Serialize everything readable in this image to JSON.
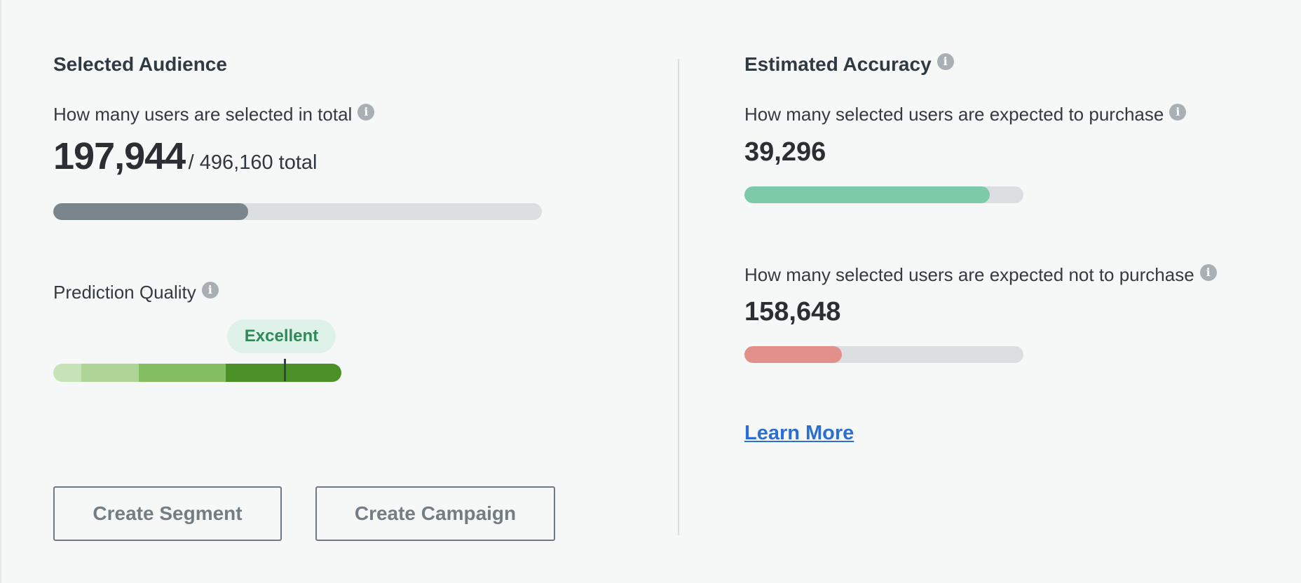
{
  "selected_audience": {
    "title": "Selected Audience",
    "question": "How many users are selected in total",
    "selected_count": "197,944",
    "total_text": "/ 496,160 total",
    "progress_fraction": 0.399,
    "bar_color": "#7b858c"
  },
  "prediction_quality": {
    "label": "Prediction Quality",
    "rating": "Excellent",
    "segment_colors": [
      "#c7e3b8",
      "#aed597",
      "#84c063",
      "#4b9128"
    ],
    "marker_fraction": 0.81
  },
  "estimated_accuracy": {
    "title": "Estimated Accuracy",
    "purchase_question": "How many selected users are expected to purchase",
    "purchase_count": "39,296",
    "purchase_fraction": 0.88,
    "purchase_color": "#7dcaa8",
    "no_purchase_question": "How many selected users are expected not to purchase",
    "no_purchase_count": "158,648",
    "no_purchase_fraction": 0.35,
    "no_purchase_color": "#e4908a",
    "learn_more": "Learn More"
  },
  "buttons": {
    "create_segment": "Create Segment",
    "create_campaign": "Create Campaign"
  },
  "icons": {
    "info": "info-icon"
  }
}
